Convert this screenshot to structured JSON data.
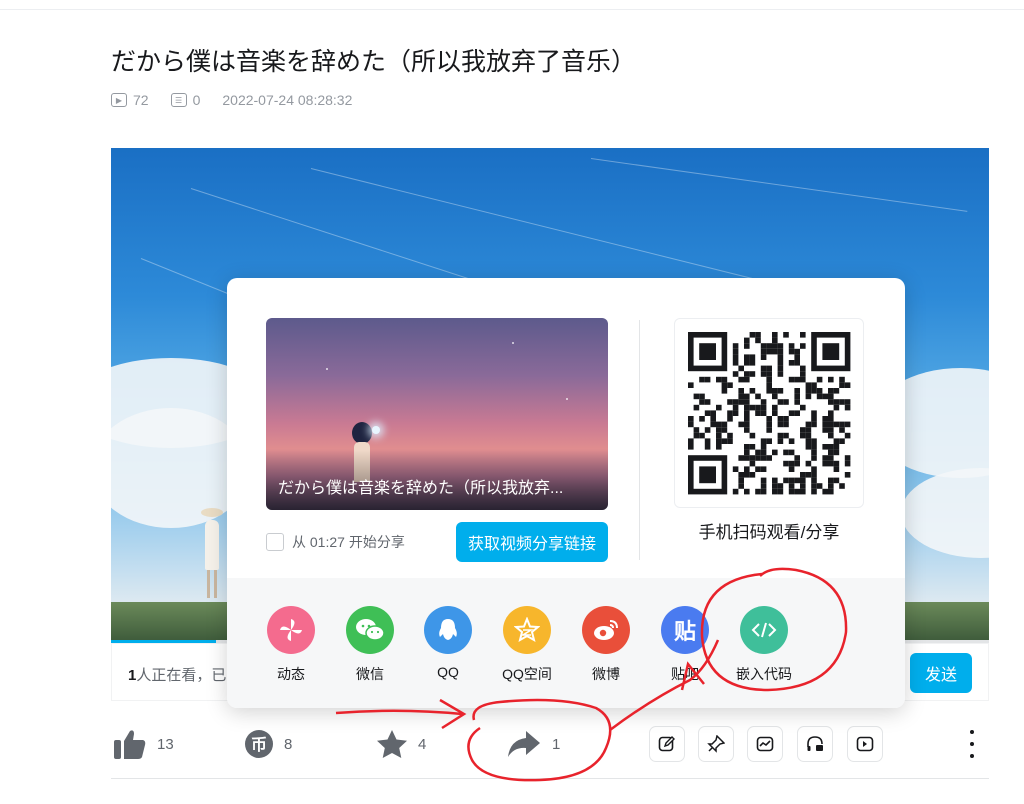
{
  "video": {
    "title": "だから僕は音楽を辞めた（所以我放弃了音乐）",
    "play_count": "72",
    "danmaku_count": "0",
    "publish_time": "2022-07-24 08:28:32"
  },
  "player": {
    "watching_count": "1",
    "watching_suffix": "人正在看，已",
    "send_label": "发送",
    "progress_fraction": 0.12
  },
  "share_popup": {
    "thumbnail_title": "だから僕は音楽を辞めた（所以我放弃...",
    "start_time_label": "从 01:27 开始分享",
    "get_link_label": "获取视频分享链接",
    "qr_label": "手机扫码观看/分享",
    "platforms": [
      {
        "label": "动态",
        "icon": "pinwheel-icon",
        "color": "#f46b8e"
      },
      {
        "label": "微信",
        "icon": "wechat-icon",
        "color": "#3fbf56"
      },
      {
        "label": "QQ",
        "icon": "qq-icon",
        "color": "#3e96e8"
      },
      {
        "label": "QQ空间",
        "icon": "qzone-star-icon",
        "color": "#f7b62c"
      },
      {
        "label": "微博",
        "icon": "weibo-icon",
        "color": "#e94f3a"
      },
      {
        "label": "贴吧",
        "icon": "tieba-icon",
        "color": "#4a7bf0",
        "glyph": "贴"
      },
      {
        "label": "嵌入代码",
        "icon": "embed-code-icon",
        "color": "#3fbf9a"
      }
    ]
  },
  "toolbar": {
    "like_count": "13",
    "coin_count": "8",
    "favorite_count": "4",
    "share_count": "1"
  },
  "colors": {
    "accent": "#00aeec",
    "annotation": "#e8232c"
  }
}
